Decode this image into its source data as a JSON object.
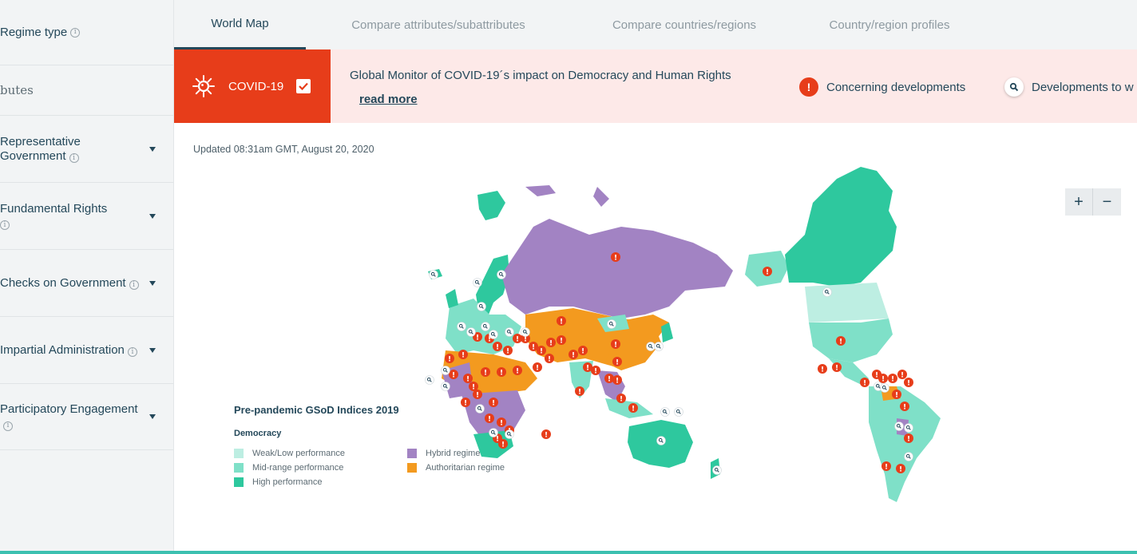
{
  "sidebar": {
    "regime_type": "Regime type",
    "attributes_heading": "butes",
    "items": [
      {
        "label": "Representative Government"
      },
      {
        "label": "Fundamental Rights"
      },
      {
        "label": "Checks on Government"
      },
      {
        "label": "Impartial Administration"
      },
      {
        "label": "Participatory Engagement"
      }
    ]
  },
  "tabs": [
    {
      "label": "World Map",
      "active": true
    },
    {
      "label": "Compare attributes/subattributes"
    },
    {
      "label": "Compare countries/regions"
    },
    {
      "label": "Country/region profiles"
    }
  ],
  "banner": {
    "covid_label": "COVID-19",
    "covid_checked": true,
    "text": "Global Monitor of COVID-19´s impact on Democracy and Human Rights",
    "read_more": "read more",
    "concerning": "Concerning developments",
    "watch": "Developments to w"
  },
  "updated": "Updated 08:31am GMT, August 20, 2020",
  "zoom": {
    "plus": "+",
    "minus": "−"
  },
  "legend": {
    "title": "Pre-pandemic GSoD Indices 2019",
    "subtitle": "Democracy",
    "items": [
      {
        "label": "Weak/Low performance",
        "color": "#bdeee2"
      },
      {
        "label": "Mid-range performance",
        "color": "#7fe0c8"
      },
      {
        "label": "High performance",
        "color": "#2ec89e"
      },
      {
        "label": "Hybrid regime",
        "color": "#a283c3"
      },
      {
        "label": "Authoritarian regime",
        "color": "#f39a1f"
      }
    ]
  },
  "colors": {
    "accent_red": "#e73d1a",
    "navy": "#24485a",
    "teal": "#2ec89e",
    "purple": "#a283c3",
    "orange": "#f39a1f",
    "banner_bg": "#fde9e8"
  }
}
